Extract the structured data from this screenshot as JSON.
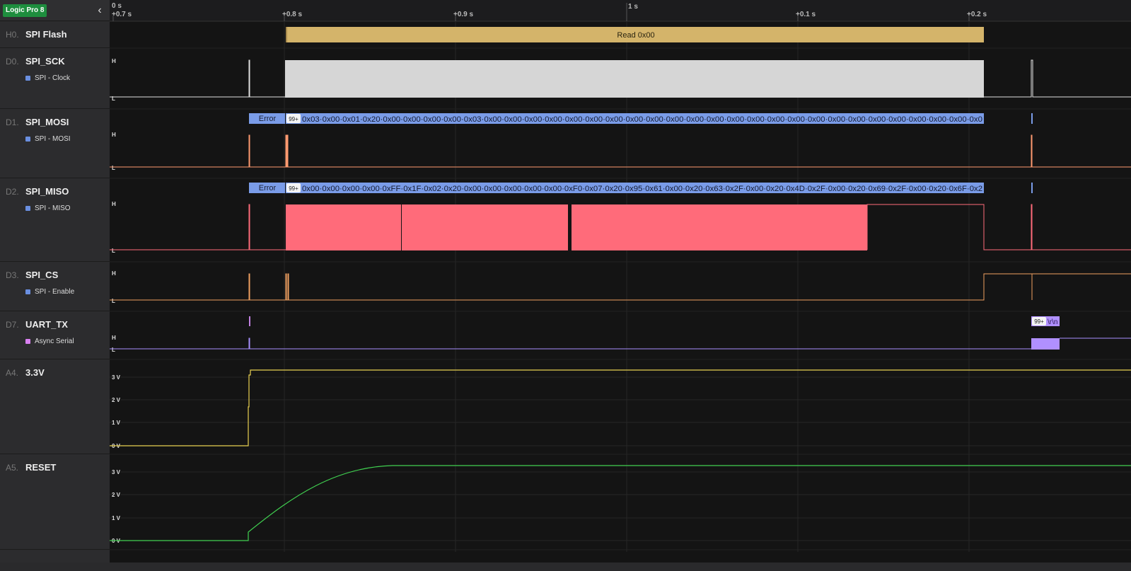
{
  "device": {
    "name": "Logic Pro 8"
  },
  "ruler": {
    "origin_label": "0 s",
    "center_label": "1 s",
    "tick_labels": [
      "+0.7 s",
      "+0.8 s",
      "+0.9 s",
      "+0.1 s",
      "+0.2 s"
    ]
  },
  "channels": [
    {
      "id": "H0.",
      "name": "SPI Flash",
      "analyzer": null
    },
    {
      "id": "D0.",
      "name": "SPI_SCK",
      "analyzer": {
        "label": "SPI - Clock",
        "color": "#6a8fe0"
      }
    },
    {
      "id": "D1.",
      "name": "SPI_MOSI",
      "analyzer": {
        "label": "SPI - MOSI",
        "color": "#6a8fe0"
      }
    },
    {
      "id": "D2.",
      "name": "SPI_MISO",
      "analyzer": {
        "label": "SPI - MISO",
        "color": "#6a8fe0"
      }
    },
    {
      "id": "D3.",
      "name": "SPI_CS",
      "analyzer": {
        "label": "SPI - Enable",
        "color": "#6a8fe0"
      }
    },
    {
      "id": "D7.",
      "name": "UART_TX",
      "analyzer": {
        "label": "Async Serial",
        "color": "#d980f0"
      }
    },
    {
      "id": "A4.",
      "name": "3.3V",
      "analyzer": null
    },
    {
      "id": "A5.",
      "name": "RESET",
      "analyzer": null
    }
  ],
  "waves": {
    "spi_flash_frame": "Read 0x00",
    "high_label": "H",
    "low_label": "L",
    "error_label": "Error",
    "overflow_badge": "99+",
    "mosi_bytes": "0x03·0x00·0x01·0x20·0x00·0x00·0x00·0x00·0x03·0x00·0x00·0x00·0x00·0x00·0x00·0x00·0x00·0x00·0x00·0x00·0x00·0x00·0x00·0x00·0x00·0x00·0x00·0x00·0x00·0x00·0x00·0x00·0x00·0x0",
    "miso_bytes": "0x00·0x00·0x00·0x00·0xFF·0x1F·0x02·0x20·0x00·0x00·0x00·0x00·0x00·0xF0·0x07·0x20·0x95·0x61·0x00·0x20·0x63·0x2F·0x00·0x20·0x4D·0x2F·0x00·0x20·0x69·0x2F·0x00·0x20·0x6F·0x2",
    "uart_frame": "\\r\\n",
    "analog_labels": [
      "3 V",
      "2 V",
      "1 V",
      "0 V"
    ]
  },
  "colors": {
    "spi_flash": "#d4b46a",
    "clock_fill": "#d6d6d6",
    "mosi_decode": "#7a9ce8",
    "miso_fill": "#ff6b7a",
    "digital_line": "#ff9a70",
    "cs_line": "#f0a060",
    "uart_line": "#a890ff",
    "uart_decode": "#b090ff",
    "analog_3v3": "#e8d050",
    "analog_reset": "#40d050"
  }
}
